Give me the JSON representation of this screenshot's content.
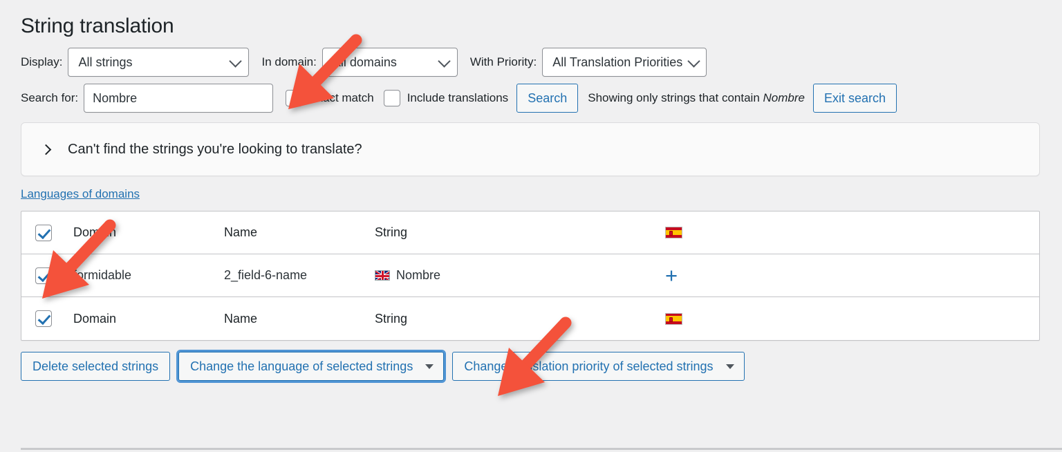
{
  "page": {
    "title": "String translation"
  },
  "filters": {
    "display_label": "Display:",
    "display_value": "All strings",
    "in_domain_label": "In domain:",
    "in_domain_value": "All domains",
    "priority_label": "With Priority:",
    "priority_value": "All Translation Priorities"
  },
  "search": {
    "label": "Search for:",
    "value": "Nombre",
    "placeholder": "",
    "exact_match_label": "Exact match",
    "exact_match_checked": false,
    "include_translations_label": "Include translations",
    "include_translations_checked": false,
    "search_button": "Search",
    "showing_prefix": "Showing only strings that contain ",
    "showing_term": "Nombre",
    "exit_search_button": "Exit search"
  },
  "accordion": {
    "label": "Can't find the strings you're looking to translate?",
    "expanded": false
  },
  "links": {
    "languages_of_domains": "Languages of domains"
  },
  "table": {
    "columns": [
      "Domain",
      "Name",
      "String",
      "es-flag"
    ],
    "header": {
      "checkbox_checked": true,
      "domain": "Domain",
      "name": "Name",
      "string": "String",
      "flag": "spain-flag-icon"
    },
    "rows": [
      {
        "checkbox_checked": true,
        "domain": "formidable",
        "name": "2_field-6-name",
        "string_flag": "uk-flag-icon",
        "string": "Nombre",
        "action": "+"
      }
    ],
    "footer": {
      "checkbox_checked": true,
      "domain": "Domain",
      "name": "Name",
      "string": "String",
      "flag": "spain-flag-icon"
    }
  },
  "bulk_actions": {
    "delete_button": "Delete selected strings",
    "change_language_button": "Change the language of selected strings",
    "change_priority_button": "Change translation priority of selected strings"
  },
  "colors": {
    "accent": "#2271b1",
    "annotation_arrow": "#f4523b",
    "page_background": "#f0f0f1",
    "border": "#8c8f94"
  },
  "annotations": [
    {
      "name": "arrow-to-exact-match",
      "target": "exact-match-checkbox"
    },
    {
      "name": "arrow-to-row-checkbox",
      "target": "table-row-checkbox"
    },
    {
      "name": "arrow-to-change-language",
      "target": "change-language-button"
    }
  ]
}
